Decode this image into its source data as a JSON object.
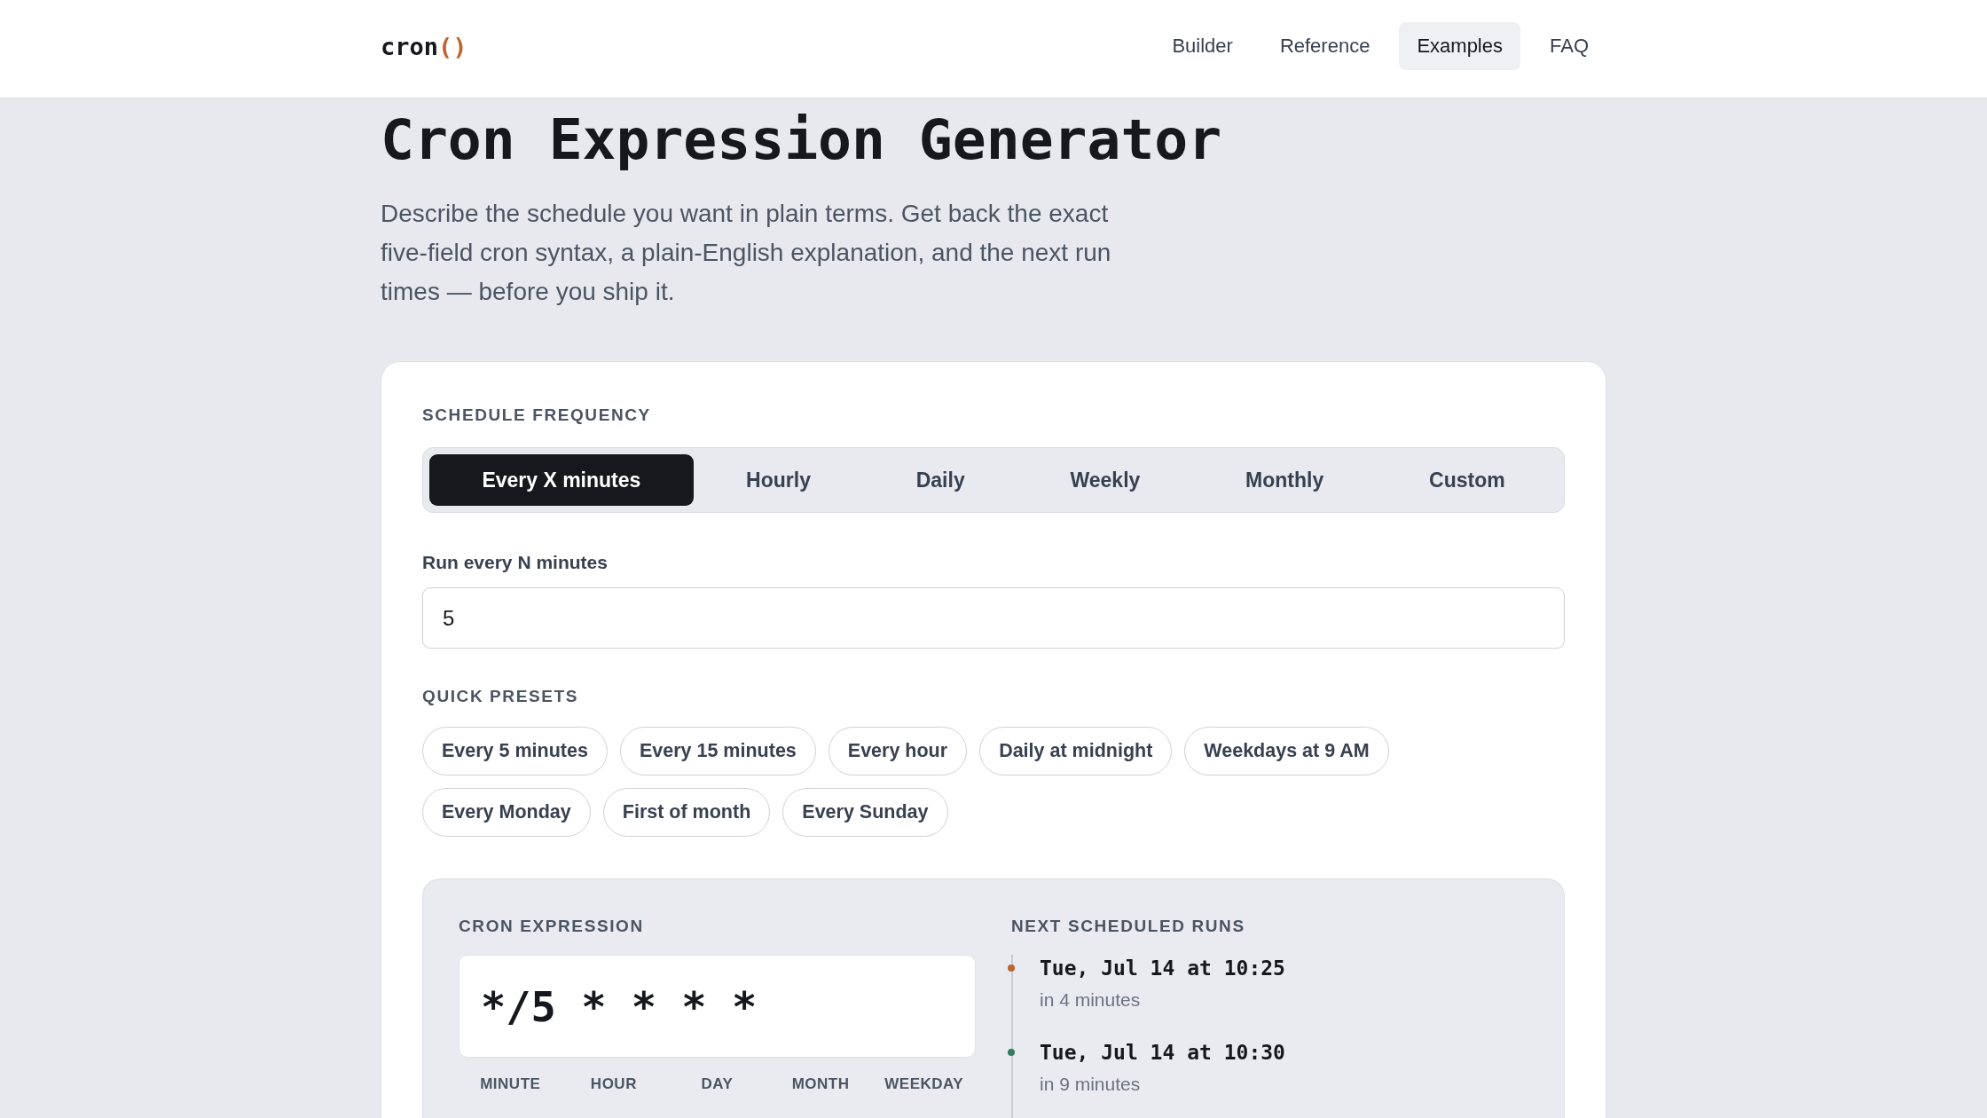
{
  "header": {
    "logo": {
      "text": "cron",
      "accent": "()"
    },
    "nav": [
      {
        "label": "Builder",
        "selected": false
      },
      {
        "label": "Reference",
        "selected": false
      },
      {
        "label": "Examples",
        "selected": true
      },
      {
        "label": "FAQ",
        "selected": false
      }
    ]
  },
  "hero": {
    "title": "Cron Expression Generator",
    "description": "Describe the schedule you want in plain terms. Get back the exact five-field cron syntax, a plain-English explanation, and the next run times — before you ship it."
  },
  "builder": {
    "frequency": {
      "label": "SCHEDULE FREQUENCY",
      "tabs": [
        {
          "label": "Every X minutes",
          "selected": true
        },
        {
          "label": "Hourly",
          "selected": false
        },
        {
          "label": "Daily",
          "selected": false
        },
        {
          "label": "Weekly",
          "selected": false
        },
        {
          "label": "Monthly",
          "selected": false
        },
        {
          "label": "Custom",
          "selected": false
        }
      ]
    },
    "interval": {
      "label": "Run every N minutes",
      "value": "5"
    },
    "presets": {
      "label": "QUICK PRESETS",
      "items": [
        "Every 5 minutes",
        "Every 15 minutes",
        "Every hour",
        "Daily at midnight",
        "Weekdays at 9 AM",
        "Every Monday",
        "First of month",
        "Every Sunday"
      ]
    },
    "result": {
      "expression": {
        "label": "CRON EXPRESSION",
        "value": "*/5 * * * *",
        "fields": [
          "MINUTE",
          "HOUR",
          "DAY",
          "MONTH",
          "WEEKDAY"
        ]
      },
      "runs": {
        "label": "NEXT SCHEDULED RUNS",
        "items": [
          {
            "time": "Tue, Jul 14 at 10:25",
            "relative": "in 4 minutes",
            "color": "#c2622d"
          },
          {
            "time": "Tue, Jul 14 at 10:30",
            "relative": "in 9 minutes",
            "color": "#2f7d5b"
          }
        ]
      }
    }
  }
}
